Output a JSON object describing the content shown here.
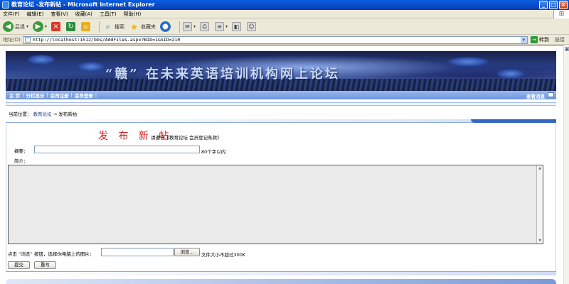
{
  "window": {
    "title": "教育论坛 -发布新帖 - Microsoft Internet Explorer",
    "buttons": [
      "_",
      "□",
      "×"
    ]
  },
  "menu": [
    "文件(F)",
    "编辑(E)",
    "查看(V)",
    "收藏(A)",
    "工具(T)",
    "帮助(H)"
  ],
  "toolbar": {
    "back_label": "后退",
    "search_label": "搜索",
    "favorites_label": "收藏夹"
  },
  "address": {
    "label": "地址(D)",
    "url": "http://localhost:1512/bbs/AddFiles.aspx?BID=1&SID=210",
    "go_label": "转到",
    "links_label": "链接"
  },
  "banner": {
    "title": "“赣” 在未来英语培训机构网上论坛"
  },
  "nav": {
    "items": [
      "主 页",
      "分栏显示",
      "会员注册",
      "会员登录"
    ],
    "messages": "查看消息"
  },
  "breadcrumb": {
    "prefix": "当前位置：",
    "forum": "教育论坛",
    "arrow": "→",
    "current": "发布新帖"
  },
  "form": {
    "heading": "发 布 新 帖",
    "agreement": "请遵守《教育论坛 会员登记条款》",
    "summary_label": "摘要：",
    "summary_value": "",
    "summary_hint": "80个字以内",
    "intro_label": "简介：",
    "intro_value": "",
    "upload_label": "点击 “浏览” 按钮，选择你电脑上的图片：",
    "file_value": "",
    "browse_label": "浏览...",
    "file_hint": "文件大小不超过300K",
    "submit_label": "提交",
    "reset_label": "重写"
  },
  "colors": {
    "heading": "#d42020",
    "nav": "#6f94dc",
    "titlebar": "#0a5ee0"
  }
}
